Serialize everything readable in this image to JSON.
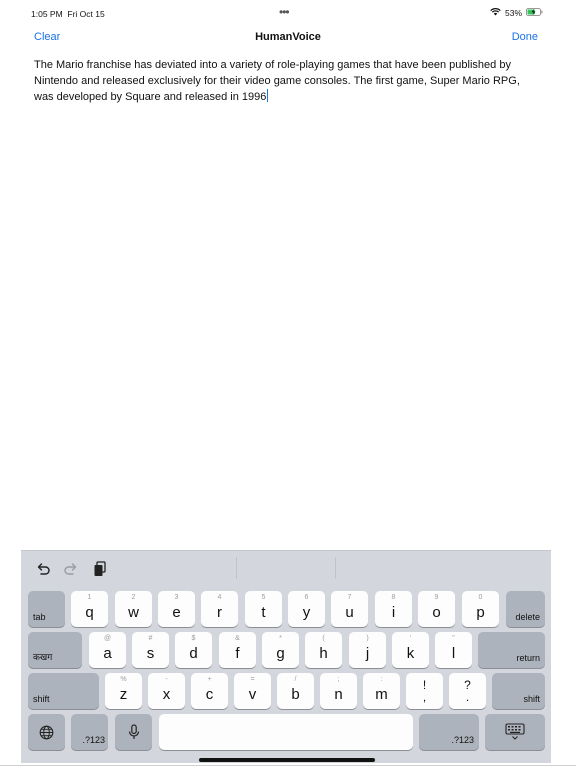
{
  "status_bar": {
    "time": "1:05 PM",
    "date": "Fri Oct 15",
    "dots": "•••",
    "battery_percent": "53%",
    "icons": [
      "wifi-icon",
      "battery-charging-icon"
    ]
  },
  "nav": {
    "clear_label": "Clear",
    "title": "HumanVoice",
    "done_label": "Done"
  },
  "editor": {
    "text": "The Mario franchise has deviated into a variety of role-playing games that have been published by Nintendo and released exclusively for their video game consoles. The first game, Super Mario RPG, was developed by Square and released in 1996"
  },
  "keyboard": {
    "shortcuts": [
      "undo-icon",
      "redo-icon",
      "paste-icon"
    ],
    "row1": {
      "tab": "tab",
      "keys": [
        {
          "hint": "1",
          "main": "q"
        },
        {
          "hint": "2",
          "main": "w"
        },
        {
          "hint": "3",
          "main": "e"
        },
        {
          "hint": "4",
          "main": "r"
        },
        {
          "hint": "5",
          "main": "t"
        },
        {
          "hint": "6",
          "main": "y"
        },
        {
          "hint": "7",
          "main": "u"
        },
        {
          "hint": "8",
          "main": "i"
        },
        {
          "hint": "9",
          "main": "o"
        },
        {
          "hint": "0",
          "main": "p"
        }
      ],
      "delete": "delete"
    },
    "row2": {
      "lang": "कखग",
      "keys": [
        {
          "hint": "@",
          "main": "a"
        },
        {
          "hint": "#",
          "main": "s"
        },
        {
          "hint": "$",
          "main": "d"
        },
        {
          "hint": "&",
          "main": "f"
        },
        {
          "hint": "*",
          "main": "g"
        },
        {
          "hint": "(",
          "main": "h"
        },
        {
          "hint": ")",
          "main": "j"
        },
        {
          "hint": "'",
          "main": "k"
        },
        {
          "hint": "\"",
          "main": "l"
        }
      ],
      "return": "return"
    },
    "row3": {
      "shift_left": "shift",
      "keys": [
        {
          "hint": "%",
          "main": "z"
        },
        {
          "hint": "-",
          "main": "x"
        },
        {
          "hint": "+",
          "main": "c"
        },
        {
          "hint": "=",
          "main": "v"
        },
        {
          "hint": "/",
          "main": "b"
        },
        {
          "hint": ";",
          "main": "n"
        },
        {
          "hint": ":",
          "main": "m"
        }
      ],
      "punct1": {
        "top": "!",
        "bottom": ","
      },
      "punct2": {
        "top": "?",
        "bottom": "."
      },
      "shift_right": "shift"
    },
    "row4": {
      "numbers_left": ".?123",
      "numbers_right": ".?123"
    }
  }
}
